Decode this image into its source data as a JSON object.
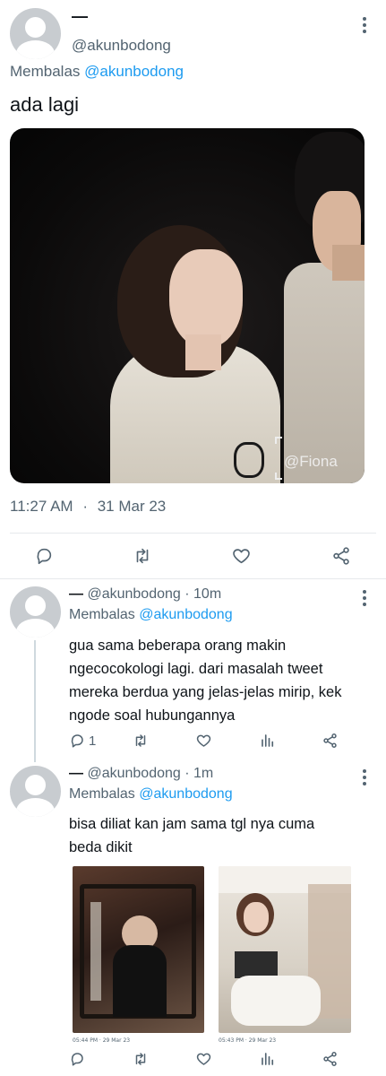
{
  "main_tweet": {
    "display_name": "—",
    "handle": "@akunbodong",
    "replying_prefix": "Membalas",
    "replying_to": "@akunbodong",
    "text": "ada lagi",
    "watermark": "@Fiona",
    "time": "11:27 AM",
    "date_sep": "·",
    "date": "31 Mar 23"
  },
  "replies": [
    {
      "display_name": "—",
      "handle": "@akunbodong",
      "time_sep": "·",
      "age": "10m",
      "replying_prefix": "Membalas",
      "replying_to": "@akunbodong",
      "text": "gua sama beberapa orang makin ngecocokologi lagi. dari masalah tweet mereka berdua yang jelas-jelas mirip, kek ngode soal hubungannya",
      "reply_count": "1"
    },
    {
      "display_name": "—",
      "handle": "@akunbodong",
      "time_sep": "·",
      "age": "1m",
      "replying_prefix": "Membalas",
      "replying_to": "@akunbodong",
      "text": "bisa diliat kan jam sama tgl nya cuma beda dikit",
      "attachments": [
        {
          "caption": "05:44 PM · 29 Mar 23"
        },
        {
          "caption": "05:43 PM · 29 Mar 23"
        }
      ]
    }
  ],
  "icons": {
    "reply": "reply-icon",
    "retweet": "retweet-icon",
    "like": "heart-icon",
    "share": "share-icon",
    "views": "views-icon",
    "more": "more-icon"
  },
  "colors": {
    "link": "#1d9bf0",
    "muted": "#536471",
    "text": "#0f1419",
    "divider": "#e6e9ec"
  }
}
